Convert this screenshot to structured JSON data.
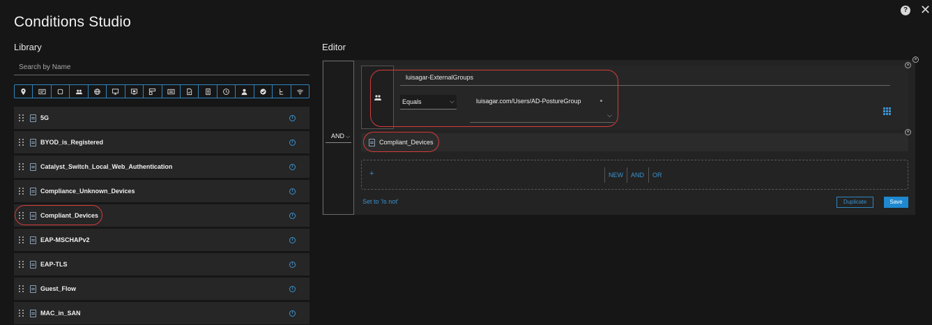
{
  "title": "Conditions Studio",
  "help_glyph": "?",
  "close_glyph": "✕",
  "library": {
    "label": "Library",
    "search_placeholder": "Search by Name",
    "icon_bar": [
      "location-pin-icon",
      "id-card-icon",
      "device-square-icon",
      "user-group-icon",
      "globe-icon",
      "monitor-icon",
      "screen-icon",
      "layout-icon",
      "id-badge-icon",
      "document-check-icon",
      "building-icon",
      "clock-icon",
      "user-icon",
      "check-circle-icon",
      "network-tree-icon",
      "wifi-icon"
    ],
    "items": [
      "5G",
      "BYOD_is_Registered",
      "Catalyst_Switch_Local_Web_Authentication",
      "Compliance_Unknown_Devices",
      "Compliant_Devices",
      "EAP-MSCHAPv2",
      "EAP-TLS",
      "Guest_Flow",
      "MAC_in_SAN"
    ],
    "info_glyph": "i"
  },
  "editor": {
    "label": "Editor",
    "operator": "AND",
    "condition1": {
      "attribute": "luisagar-ExternalGroups",
      "op": "Equals",
      "value": "luisagar.com/Users/AD-PostureGroup"
    },
    "condition2": {
      "name": "Compliant_Devices"
    },
    "new_actions": {
      "plus": "+",
      "new": "NEW",
      "and": "AND",
      "or": "OR"
    },
    "set_not": "Set to 'Is not'",
    "duplicate": "Duplicate",
    "save": "Save",
    "remove_glyph": "×"
  },
  "colors": {
    "accent": "#3a93d0",
    "highlight": "#d63c3c",
    "background": "#161616"
  }
}
